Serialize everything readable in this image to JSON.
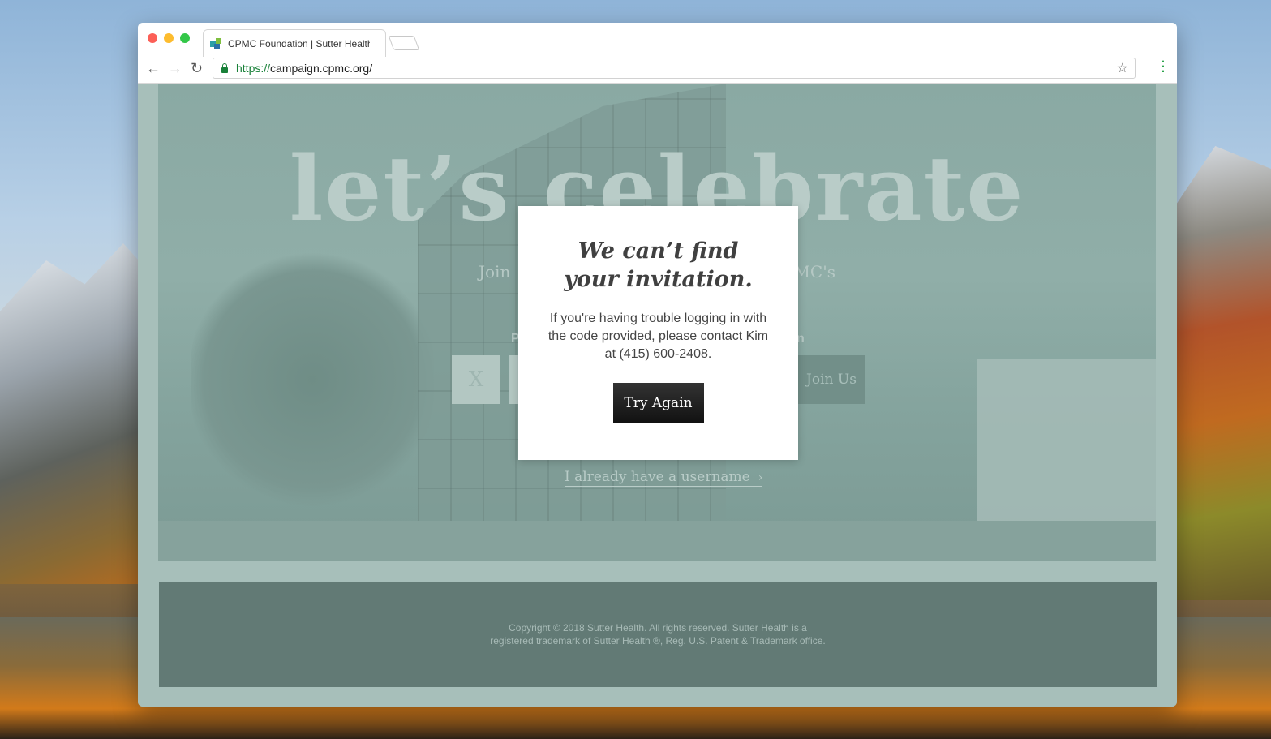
{
  "browser": {
    "tab_title": "CPMC Foundation | Sutter Health",
    "url_scheme": "https://",
    "url_host": "campaign.cpmc.org/"
  },
  "hero": {
    "heading": "let’s celebrate",
    "subtitle_left": "Join",
    "subtitle_right": "MC's",
    "prompt_left": "P",
    "prompt_right": "n",
    "code_placeholder": "X",
    "join_button": "Join Us",
    "username_link": "I already have a username"
  },
  "modal": {
    "title_line1": "We can’t find",
    "title_line2": "your invitation.",
    "body": "If you're having trouble logging in with the code provided, please contact Kim at (415) 600-2408.",
    "button": "Try Again"
  },
  "footer": {
    "line1": "Copyright © 2018 Sutter Health. All rights reserved. Sutter Health is a",
    "line2": "registered trademark of Sutter Health ®, Reg. U.S. Patent & Trademark office."
  },
  "colors": {
    "page_overlay": "#a7bfba",
    "footer_bg": "#627a75",
    "button_bg": "#1a1a1a"
  }
}
